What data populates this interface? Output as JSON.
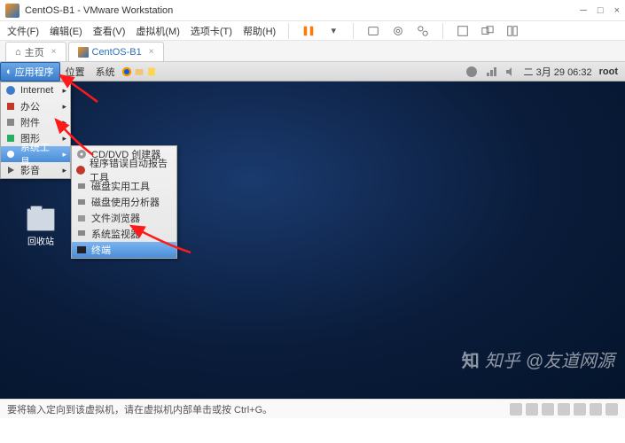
{
  "window": {
    "title": "CentOS-B1 - VMware Workstation"
  },
  "menubar": [
    "文件(F)",
    "编辑(E)",
    "查看(V)",
    "虚拟机(M)",
    "选项卡(T)",
    "帮助(H)"
  ],
  "tabs": {
    "home": "主页",
    "vm": "CentOS-B1"
  },
  "centos_panel": {
    "apps": "应用程序",
    "places": "位置",
    "system": "系统",
    "clock": "二  3月 29 06:32",
    "user": "root"
  },
  "app_menu": [
    {
      "label": "Internet"
    },
    {
      "label": "办公"
    },
    {
      "label": "附件"
    },
    {
      "label": "图形"
    },
    {
      "label": "系统工具",
      "hi": true
    },
    {
      "label": "影音"
    }
  ],
  "submenu": [
    "CD/DVD 创建器",
    "程序错误自动报告工具",
    "磁盘实用工具",
    "磁盘使用分析器",
    "文件浏览器",
    "系统监视器",
    "终端"
  ],
  "desktop": {
    "trash": "回收站"
  },
  "statusbar": {
    "hint": "要将输入定向到该虚拟机，请在虚拟机内部单击或按 Ctrl+G。"
  },
  "watermark": {
    "site": "知乎",
    "author": "@友道网源"
  }
}
